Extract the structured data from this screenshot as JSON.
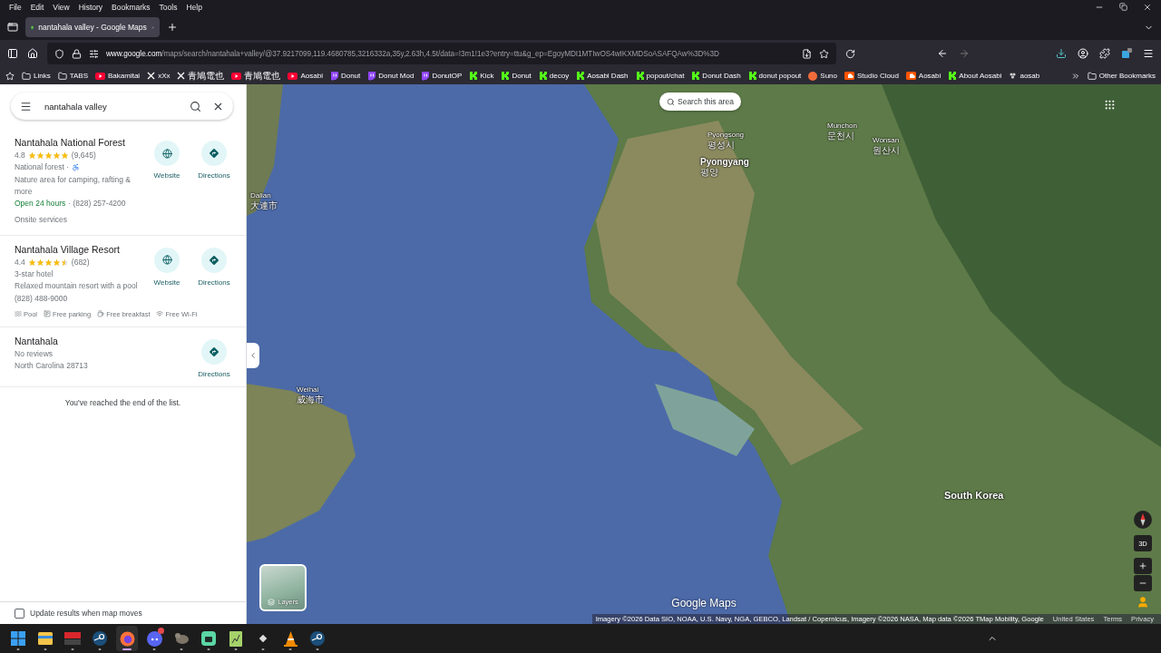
{
  "browser": {
    "menu": [
      "File",
      "Edit",
      "View",
      "History",
      "Bookmarks",
      "Tools",
      "Help"
    ],
    "tabs": [
      {
        "title": "nantahala valley - Google Maps",
        "selected": true
      }
    ],
    "url": {
      "domain": "www.google.com",
      "path": "/maps/search/nantahala+valley/@37.9217099,119.4680785,3216332a,35y,2.63h,4.5t/data=!3m1!1e3?entry=ttu&g_ep=EgoyMDI1MTIwOS4wIKXMDSoASAFQAw%3D%3D"
    },
    "bookmarks": [
      {
        "kind": "folder",
        "label": "Links"
      },
      {
        "kind": "folder",
        "label": "TABS"
      },
      {
        "kind": "youtube",
        "label": "Bakamitai"
      },
      {
        "kind": "x",
        "label": "xXx"
      },
      {
        "kind": "x",
        "label": "青鳩電也"
      },
      {
        "kind": "youtube",
        "label": "青鳩電也"
      },
      {
        "kind": "youtube",
        "label": "Aosabi"
      },
      {
        "kind": "twitch",
        "label": "Donut"
      },
      {
        "kind": "twitch",
        "label": "Donut Mod"
      },
      {
        "kind": "twitch",
        "label": "DonutOP"
      },
      {
        "kind": "kick",
        "label": "Kick"
      },
      {
        "kind": "kick",
        "label": "Donut"
      },
      {
        "kind": "kick",
        "label": "decoy"
      },
      {
        "kind": "kick",
        "label": "Aosabi Dash"
      },
      {
        "kind": "kick",
        "label": "popout/chat"
      },
      {
        "kind": "kick",
        "label": "Donut Dash"
      },
      {
        "kind": "kick",
        "label": "donut popout"
      },
      {
        "kind": "suno",
        "label": "Suno"
      },
      {
        "kind": "soundcloud",
        "label": "Studio Cloud"
      },
      {
        "kind": "soundcloud",
        "label": "Aosabi"
      },
      {
        "kind": "kick",
        "label": "About Aosabi"
      },
      {
        "kind": "misc",
        "label": "aosab"
      }
    ],
    "other_bookmarks": "Other Bookmarks"
  },
  "maps": {
    "search": {
      "value": "nantahala valley"
    },
    "results": [
      {
        "name": "Nantahala National Forest",
        "rating": "4.8",
        "stars": 5,
        "reviews": "(9,645)",
        "category": "National forest ·",
        "accessible": true,
        "description": "Nature area for camping, rafting & more",
        "hours": "Open 24 hours",
        "phone": "· (828) 257-4200",
        "extra": "Onsite services",
        "actions": [
          {
            "kind": "website",
            "label": "Website"
          },
          {
            "kind": "directions",
            "label": "Directions"
          }
        ]
      },
      {
        "name": "Nantahala Village Resort",
        "rating": "4.4",
        "stars": 4.5,
        "reviews": "(682)",
        "category": "3-star hotel",
        "accessible": false,
        "description": "Relaxed mountain resort with a pool",
        "phone": "(828) 488-9000",
        "amenities": [
          {
            "kind": "pool",
            "label": "Pool"
          },
          {
            "kind": "parking",
            "label": "Free parking"
          },
          {
            "kind": "breakfast",
            "label": "Free breakfast"
          },
          {
            "kind": "wifi",
            "label": "Free Wi-Fi"
          }
        ],
        "actions": [
          {
            "kind": "website",
            "label": "Website"
          },
          {
            "kind": "directions",
            "label": "Directions"
          }
        ]
      },
      {
        "name": "Nantahala",
        "reviews": "No reviews",
        "address": "North Carolina 28713",
        "actions": [
          {
            "kind": "directions",
            "label": "Directions"
          }
        ]
      }
    ],
    "end_of_list": "You've reached the end of the list.",
    "update_results": {
      "label": "Update results when map moves",
      "checked": false
    },
    "map": {
      "search_area": "Search this area",
      "labels": [
        {
          "name": "Pyongsong",
          "native": "평성시",
          "kind": "city"
        },
        {
          "name": "Pyongyang",
          "native": "평양",
          "kind": "capital"
        },
        {
          "name": "Munchon",
          "native": "문천시",
          "kind": "city"
        },
        {
          "name": "Wonsan",
          "native": "원산시",
          "kind": "city"
        },
        {
          "name": "Dalian",
          "native": "大連市",
          "kind": "city"
        },
        {
          "name": "Weihai",
          "native": "威海市",
          "kind": "city"
        },
        {
          "name": "South Korea",
          "kind": "country"
        }
      ],
      "three_d": "3D",
      "layers": "Layers",
      "wordmark": "Google Maps",
      "attribution": "Imagery ©2026 Data SIO, NOAA, U.S. Navy, NGA, GEBCO, Landsat / Copernicus, Imagery ©2026 NASA, Map data ©2026 TMap Mobility, Google",
      "footer_links": [
        "United States",
        "Terms",
        "Privacy"
      ]
    }
  },
  "taskbar": {
    "apps": [
      {
        "kind": "windows",
        "active": false,
        "notification": false
      },
      {
        "kind": "explorer",
        "active": false,
        "notification": false
      },
      {
        "kind": "mixer",
        "active": false,
        "notification": false
      },
      {
        "kind": "steam",
        "active": false,
        "notification": false
      },
      {
        "kind": "firefox",
        "active": true,
        "notification": false
      },
      {
        "kind": "discord",
        "active": false,
        "notification": true
      },
      {
        "kind": "gimp",
        "active": false,
        "notification": false
      },
      {
        "kind": "green",
        "active": false,
        "notification": false
      },
      {
        "kind": "notepad",
        "active": false,
        "notification": false
      },
      {
        "kind": "diamond",
        "active": false,
        "notification": false
      },
      {
        "kind": "cone",
        "active": false,
        "notification": false
      },
      {
        "kind": "steam",
        "active": false,
        "notification": false
      }
    ]
  }
}
